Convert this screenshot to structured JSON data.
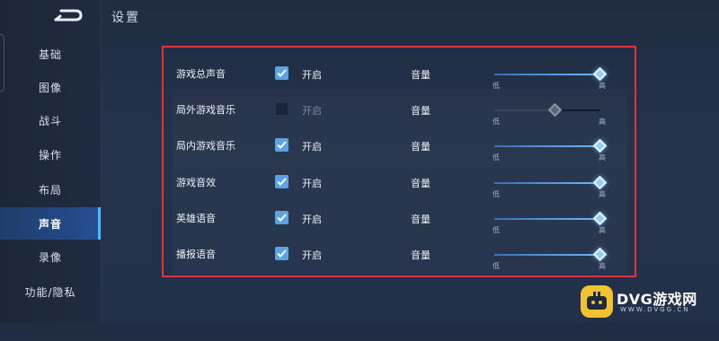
{
  "header": {
    "title": "设置"
  },
  "sidebar": {
    "items": [
      {
        "label": "基础",
        "active": false
      },
      {
        "label": "图像",
        "active": false
      },
      {
        "label": "战斗",
        "active": false
      },
      {
        "label": "操作",
        "active": false
      },
      {
        "label": "布局",
        "active": false
      },
      {
        "label": "声音",
        "active": true
      },
      {
        "label": "录像",
        "active": false
      },
      {
        "label": "功能/隐私",
        "active": false
      },
      {
        "label": "",
        "active": false
      }
    ]
  },
  "settings": {
    "rows": [
      {
        "label": "游戏总声音",
        "enabled": true,
        "toggle_text": "开启",
        "volume_label": "音量",
        "low_label": "低",
        "high_label": "高",
        "volume": 1.0
      },
      {
        "label": "局外游戏音乐",
        "enabled": false,
        "toggle_text": "开启",
        "volume_label": "音量",
        "low_label": "低",
        "high_label": "高",
        "volume": 0.58
      },
      {
        "label": "局内游戏音乐",
        "enabled": true,
        "toggle_text": "开启",
        "volume_label": "音量",
        "low_label": "低",
        "high_label": "高",
        "volume": 1.0
      },
      {
        "label": "游戏音效",
        "enabled": true,
        "toggle_text": "开启",
        "volume_label": "音量",
        "low_label": "低",
        "high_label": "高",
        "volume": 1.0
      },
      {
        "label": "英雄语音",
        "enabled": true,
        "toggle_text": "开启",
        "volume_label": "音量",
        "low_label": "低",
        "high_label": "高",
        "volume": 1.0
      },
      {
        "label": "播报语音",
        "enabled": true,
        "toggle_text": "开启",
        "volume_label": "音量",
        "low_label": "低",
        "high_label": "高",
        "volume": 1.0
      }
    ]
  },
  "watermark": {
    "name": "DVG游戏网",
    "url": "WWW.DVGG.CN"
  },
  "colors": {
    "highlight_border": "#e0343a",
    "accent": "#5aa3e6",
    "active_tab": "#2c6ccc"
  }
}
